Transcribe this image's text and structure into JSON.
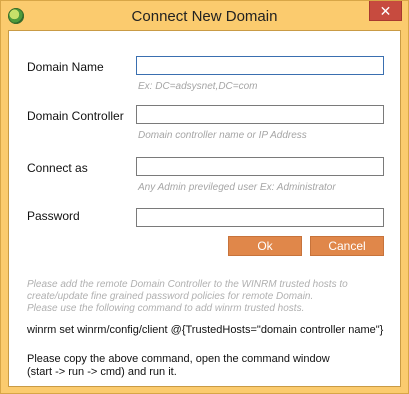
{
  "window": {
    "title": "Connect New Domain",
    "close_glyph": "✕",
    "icon": "app-icon"
  },
  "form": {
    "domain_name": {
      "label": "Domain Name",
      "value": "",
      "hint": "Ex: DC=adsysnet,DC=com"
    },
    "domain_controller": {
      "label": "Domain Controller",
      "value": "",
      "hint": "Domain controller name or  IP Address"
    },
    "connect_as": {
      "label": "Connect as",
      "value": "",
      "hint": "Any Admin previleged user Ex: Administrator"
    },
    "password": {
      "label": "Password",
      "value": ""
    }
  },
  "buttons": {
    "ok": "Ok",
    "cancel": "Cancel"
  },
  "note": [
    "Please add the remote Domain Controller to the WINRM trusted hosts to",
    "create/update fine grained password policies for remote Domain.",
    "Please use the following command to add winrm trusted hosts."
  ],
  "command": "winrm set winrm/config/client @{TrustedHosts=\"domain controller name\"}",
  "instructions": [
    "Please copy the above command, open the command window",
    "(start -> run -> cmd) and run it."
  ],
  "colors": {
    "frame": "#fbcb6e",
    "button": "#e0874a",
    "close": "#c74b3f",
    "hint": "#a5a5a5"
  }
}
